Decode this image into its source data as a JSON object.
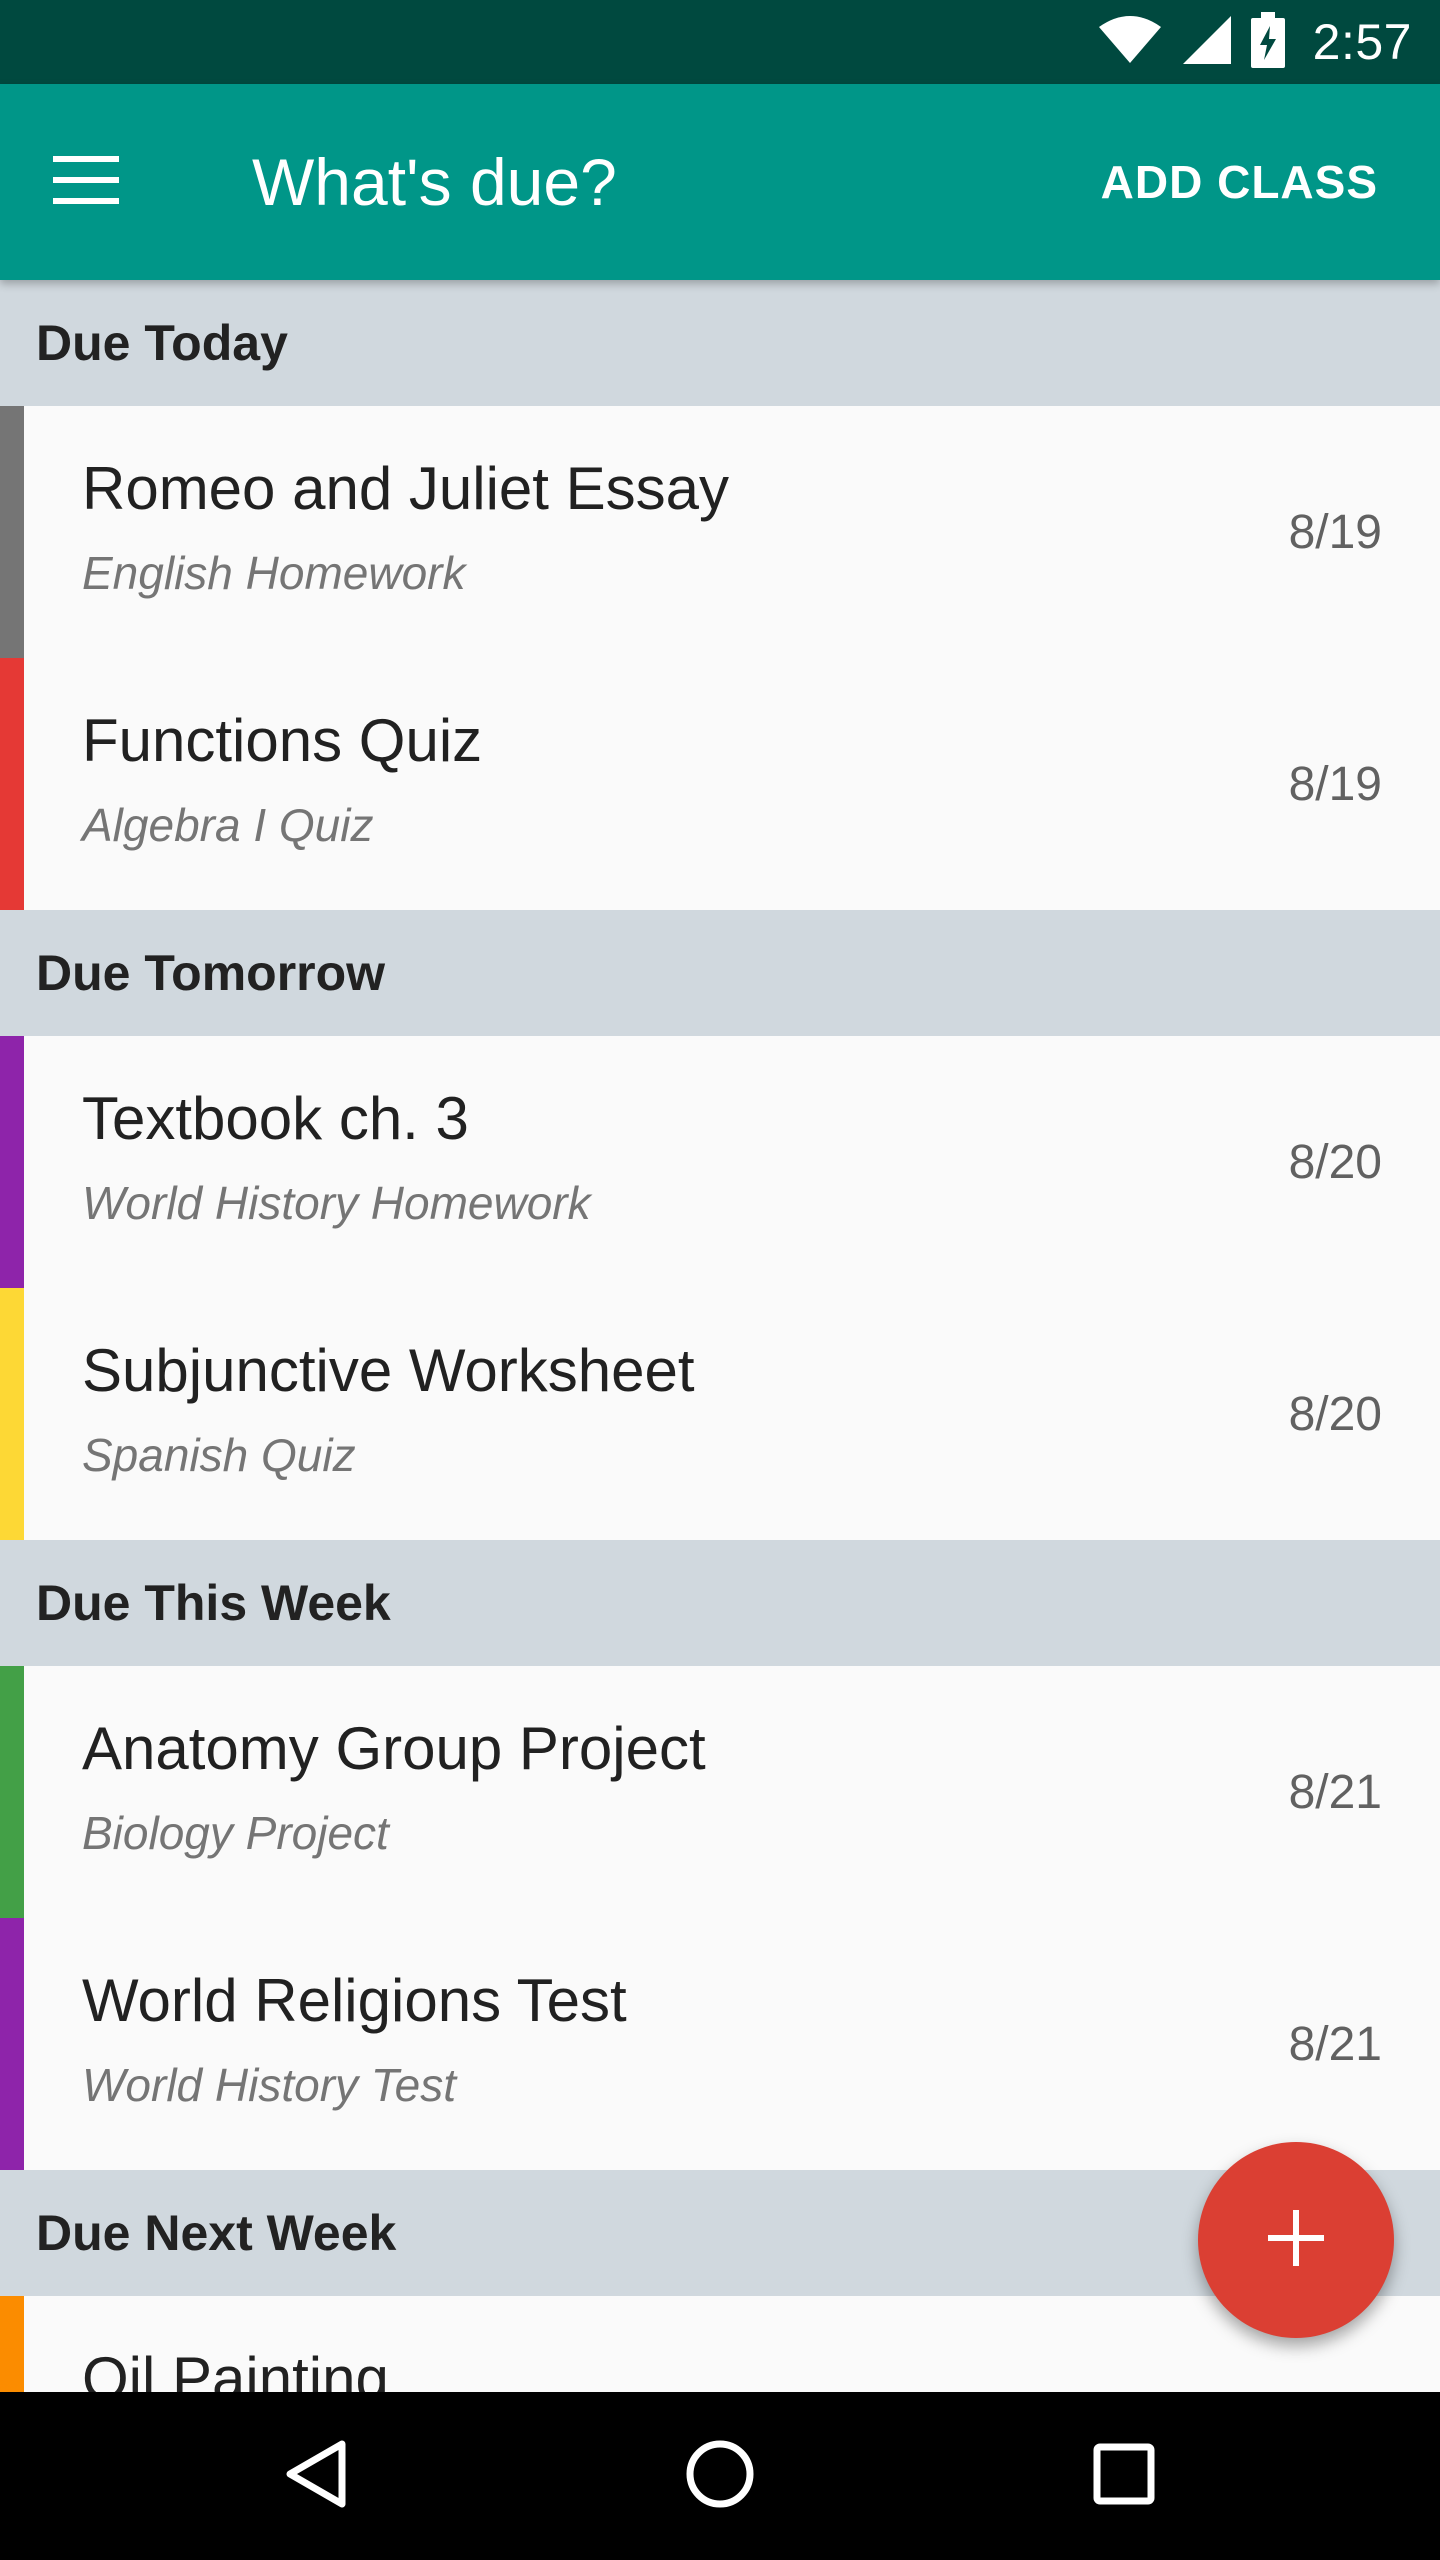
{
  "status_bar": {
    "time": "2:57",
    "icons": [
      "wifi-icon",
      "cell-signal-icon",
      "battery-charging-icon"
    ]
  },
  "app_bar": {
    "title": "What's due?",
    "action_label": "ADD CLASS",
    "menu_icon": "hamburger-menu-icon",
    "background": "#009688"
  },
  "sections": [
    {
      "header": "Due Today",
      "items": [
        {
          "title": "Romeo and Juliet Essay",
          "subtitle": "English Homework",
          "date": "8/19",
          "color": "#757575"
        },
        {
          "title": "Functions Quiz",
          "subtitle": "Algebra I Quiz",
          "date": "8/19",
          "color": "#e53935"
        }
      ]
    },
    {
      "header": "Due Tomorrow",
      "items": [
        {
          "title": "Textbook ch. 3",
          "subtitle": "World History Homework",
          "date": "8/20",
          "color": "#8e24aa"
        },
        {
          "title": "Subjunctive Worksheet",
          "subtitle": "Spanish Quiz",
          "date": "8/20",
          "color": "#fdd835"
        }
      ]
    },
    {
      "header": "Due This Week",
      "items": [
        {
          "title": "Anatomy Group Project",
          "subtitle": "Biology Project",
          "date": "8/21",
          "color": "#43a047"
        },
        {
          "title": "World Religions Test",
          "subtitle": "World History Test",
          "date": "8/21",
          "color": "#8e24aa"
        }
      ]
    },
    {
      "header": "Due Next Week",
      "items": [
        {
          "title": "Oil Painting",
          "subtitle": "",
          "date": "",
          "color": "#fb8c00"
        }
      ]
    }
  ],
  "fab": {
    "icon": "plus-icon",
    "color": "#db3f33"
  },
  "nav_bar": {
    "icons": [
      "back-icon",
      "home-icon",
      "recents-icon"
    ]
  }
}
